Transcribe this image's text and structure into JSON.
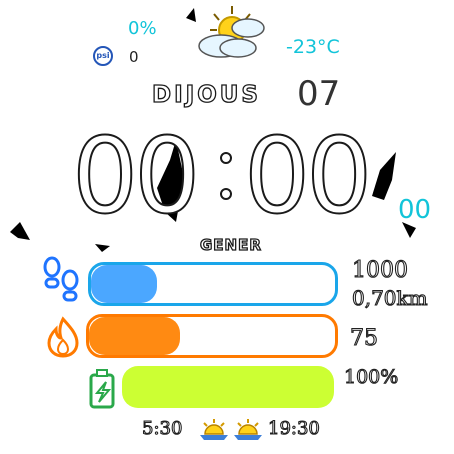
{
  "weather": {
    "precip_percent": "0%",
    "pressure_value": "0",
    "temperature": "-23°C",
    "accent_color": "#12c4d9"
  },
  "date": {
    "weekday": "DIJOUS",
    "day": "07",
    "month": "GENER"
  },
  "time": {
    "hours": "00",
    "minutes": "00",
    "seconds": "00"
  },
  "steps": {
    "goal": "1000",
    "distance": "0,70km",
    "progress": 0.27,
    "color": "#4ba7ff"
  },
  "calories": {
    "value": "75",
    "progress": 0.37,
    "color": "#ff8a12"
  },
  "battery": {
    "value": "100%",
    "progress": 1.0,
    "color": "#ccff33"
  },
  "sun": {
    "sunrise": "5:30",
    "sunset": "19:30"
  }
}
